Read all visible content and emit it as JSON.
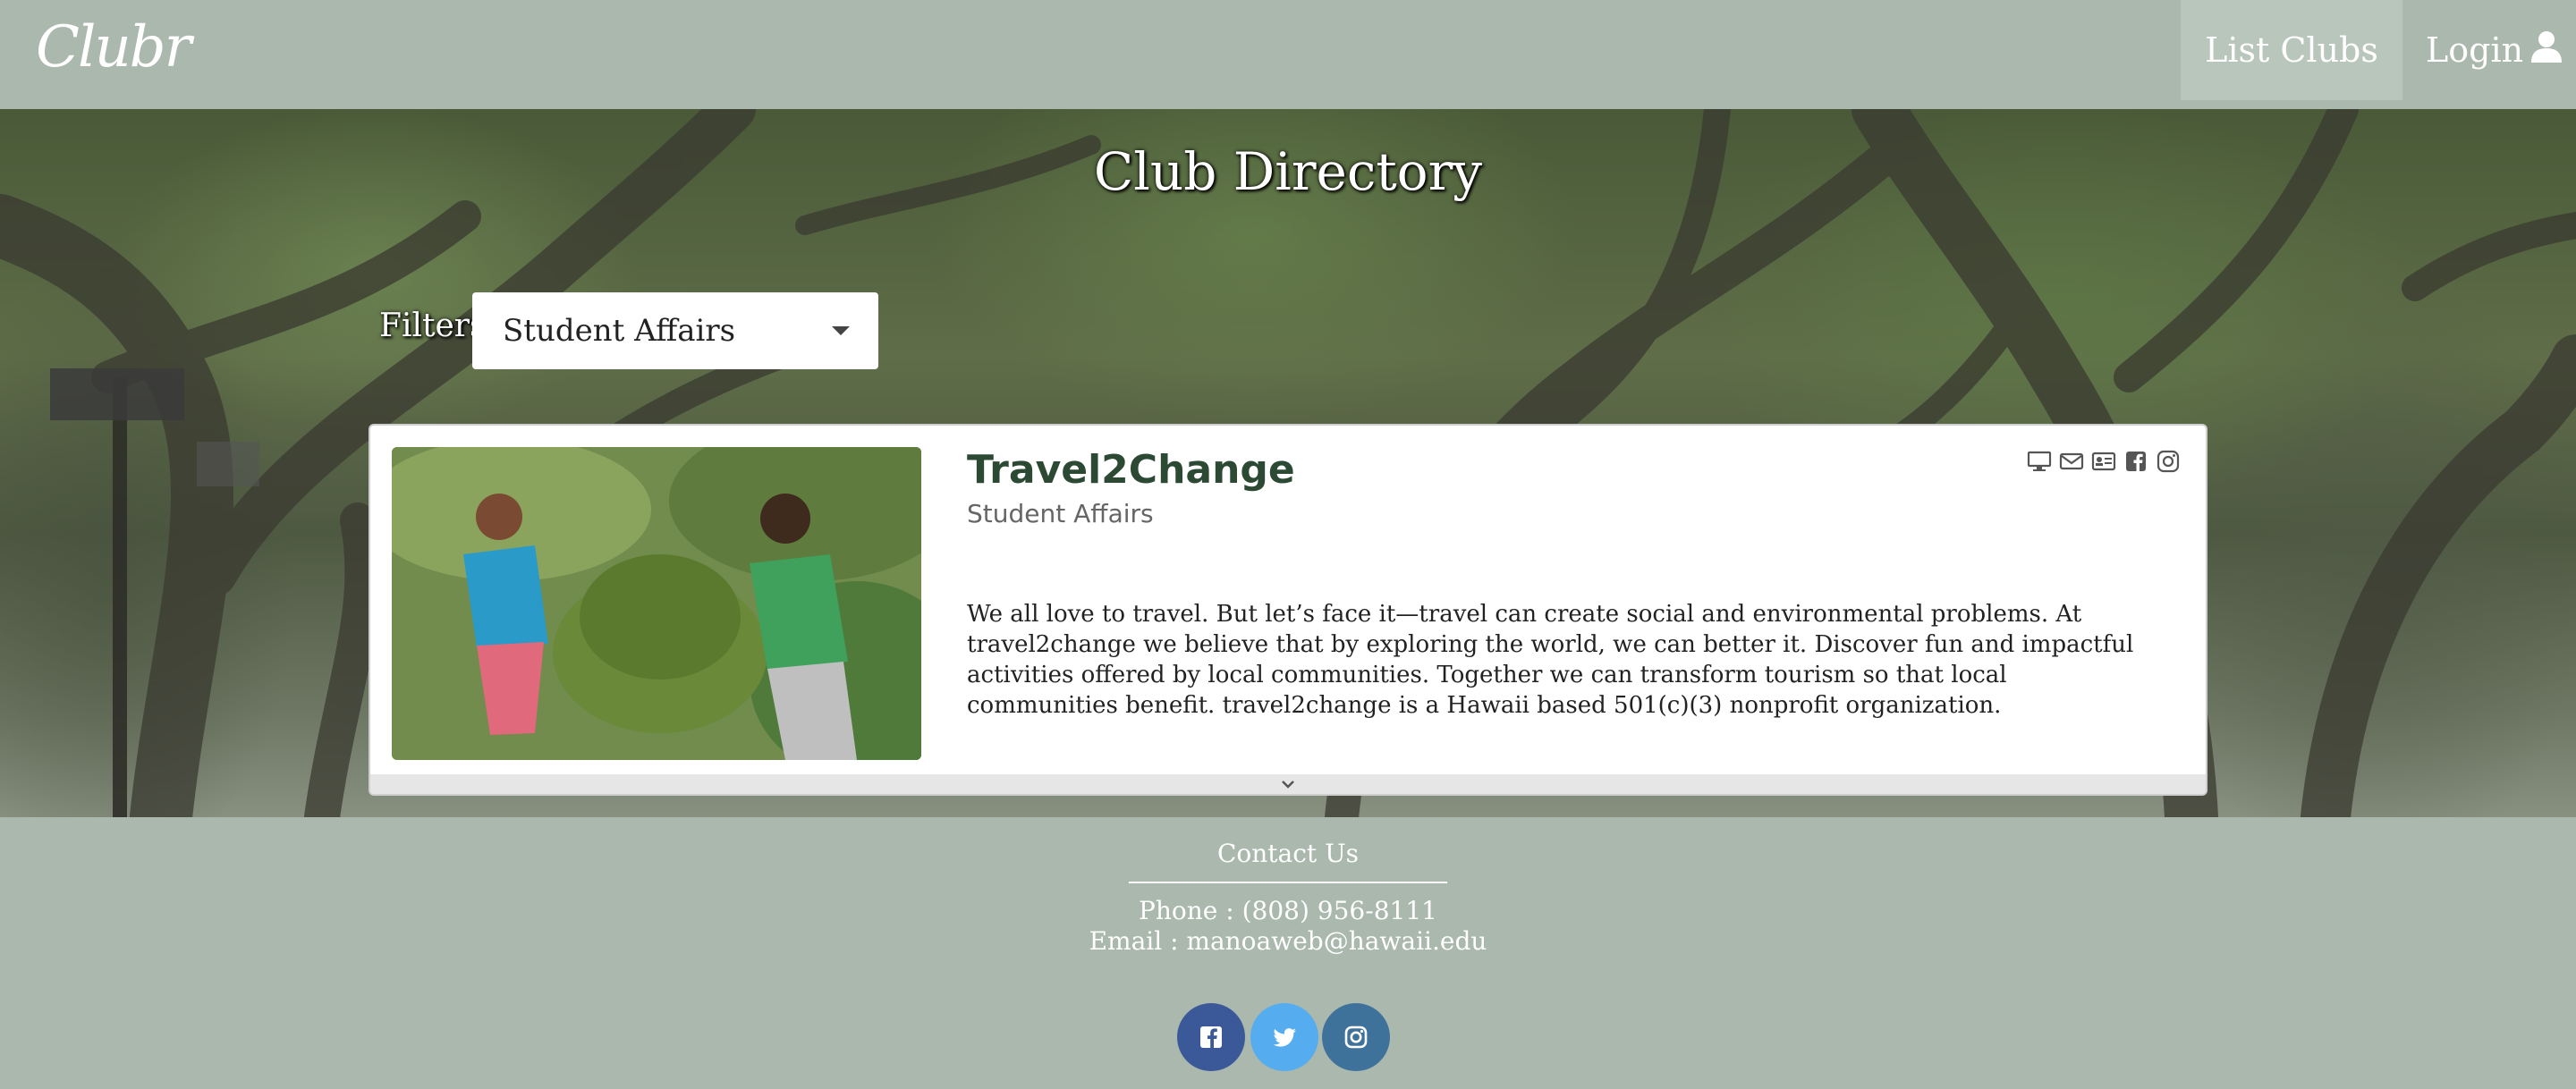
{
  "nav": {
    "logo": "Clubr",
    "list_clubs": "List Clubs",
    "login": "Login"
  },
  "hero": {
    "title": "Club Directory",
    "filters_label": "Filters",
    "filter_value": "Student Affairs"
  },
  "card": {
    "name": "Travel2Change",
    "category": "Student Affairs",
    "description": "We all love to travel. But let’s face it—travel can create social and environmental problems. At travel2change we believe that by exploring the world, we can better it. Discover fun and impactful activities offered by local communities. Together we can transform tourism so that local communities benefit. travel2change is a Hawaii based 501(c)(3) nonprofit organization.",
    "icons": [
      "website-icon",
      "email-icon",
      "contact-card-icon",
      "facebook-icon",
      "instagram-icon"
    ]
  },
  "footer": {
    "contact_title": "Contact Us",
    "phone": "Phone : (808) 956-8111",
    "email": "Email : manoaweb@hawaii.edu",
    "social": [
      "facebook",
      "twitter",
      "instagram"
    ]
  },
  "colors": {
    "nav_bg": "#aab8ad",
    "nav_active_bg": "#b9c6bc",
    "club_name": "#2c4a33",
    "facebook": "#3b5998",
    "twitter": "#55acee",
    "instagram": "#3f729b"
  }
}
